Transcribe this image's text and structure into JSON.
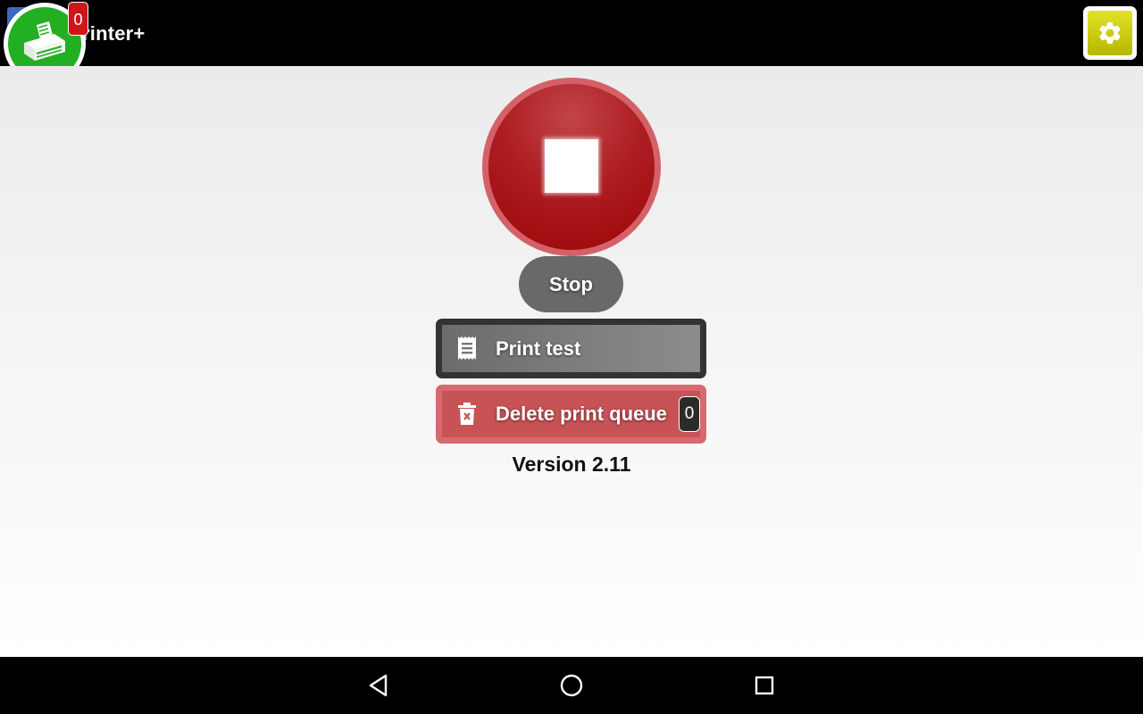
{
  "appbar": {
    "title": "Printer+",
    "title_visible_fragment": "rinter+",
    "queue_count": "0",
    "printer_icon": "printer-icon",
    "settings_icon": "gear-icon"
  },
  "main": {
    "stop_icon": "stop-icon",
    "stop_label": "Stop",
    "print_test_label": "Print test",
    "print_test_icon": "receipt-icon",
    "delete_queue_label": "Delete print queue",
    "delete_queue_icon": "trash-icon",
    "delete_queue_count": "0",
    "version_text": "Version 2.11"
  },
  "navbar": {
    "back_icon": "back-icon",
    "home_icon": "home-icon",
    "recents_icon": "recents-icon"
  },
  "colors": {
    "stop_red": "#9c0506",
    "stop_ring": "#d46168",
    "printer_green": "#22b022",
    "badge_red": "#d0151a",
    "settings_yellow": "#c9c80f",
    "delete_red": "#c75356",
    "print_test_gray": "#7a7a7a"
  }
}
